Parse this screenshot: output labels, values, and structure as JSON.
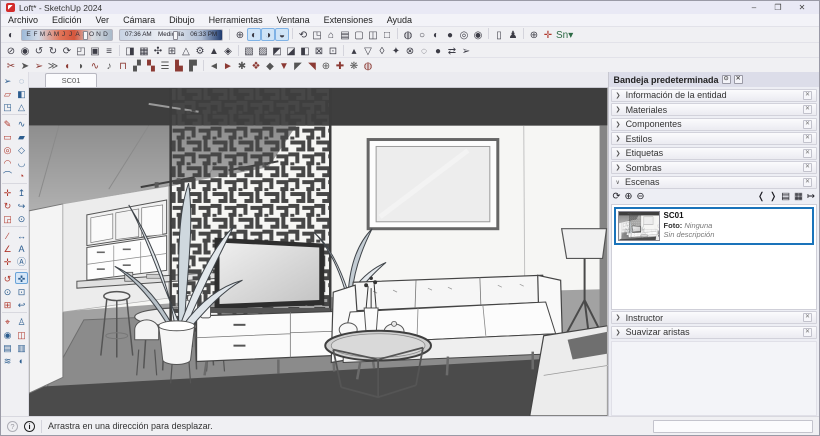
{
  "colors": {
    "accent": "#2b7cd3",
    "selection_border": "#1a73ba",
    "pressed_bg": "#cfe4f7",
    "shadow_red": "#d4563c"
  },
  "window": {
    "title": "Loft* - SketchUp 2024",
    "minimize": "–",
    "restore": "❐",
    "close": "✕"
  },
  "menu": {
    "items": [
      "Archivo",
      "Edición",
      "Ver",
      "Cámara",
      "Dibujo",
      "Herramientas",
      "Ventana",
      "Extensiones",
      "Ayuda"
    ]
  },
  "shadow_toolbar": {
    "toggle": {
      "n": "shadow-settings-icon",
      "g": "◐"
    },
    "months": [
      "E",
      "F",
      "M",
      "A",
      "M",
      "J",
      "J",
      "A",
      "S",
      "O",
      "N",
      "D"
    ],
    "time_start": "07:36 AM",
    "time_noon": "Mediodía",
    "time_end": "06:33 PM"
  },
  "toolbar_row1": [
    {
      "n": "compass-icon",
      "g": "⊕"
    },
    {
      "n": "shadows-toggle-icon",
      "g": "◐",
      "pressed": true
    },
    {
      "n": "shadow-on-faces-icon",
      "g": "◑",
      "pressed": true
    },
    {
      "n": "shadow-on-ground-icon",
      "g": "◒",
      "pressed": true
    },
    {
      "sep": true
    },
    {
      "n": "previous-view-icon",
      "g": "⟲"
    },
    {
      "n": "iso-view-icon",
      "g": "◳"
    },
    {
      "n": "home-view-icon",
      "g": "⌂"
    },
    {
      "n": "top-view-icon",
      "g": "▤"
    },
    {
      "n": "front-view-icon",
      "g": "▢"
    },
    {
      "n": "right-view-icon",
      "g": "◫"
    },
    {
      "n": "back-view-icon",
      "g": "□"
    },
    {
      "sep": true
    },
    {
      "n": "xray-style-icon",
      "g": "◍"
    },
    {
      "n": "wireframe-style-icon",
      "g": "○"
    },
    {
      "n": "hidden-line-style-icon",
      "g": "◐"
    },
    {
      "n": "shaded-style-icon",
      "g": "●"
    },
    {
      "n": "textured-style-icon",
      "g": "◎"
    },
    {
      "n": "monochrome-style-icon",
      "g": "◉"
    },
    {
      "sep": true
    },
    {
      "n": "new-file-icon",
      "g": "▯"
    },
    {
      "n": "person-scale-icon",
      "g": "♟"
    },
    {
      "sep": true
    },
    {
      "n": "geolocation-globe-icon",
      "g": "⊕"
    },
    {
      "n": "axes-icon",
      "g": "✛",
      "c": "#b0392e"
    },
    {
      "n": "sandbox-dropdown-icon",
      "g": "Sn▾",
      "c": "#2e6b46"
    }
  ],
  "toolbar_row2": [
    {
      "n": "extension-icon-r2-01",
      "g": "⊘"
    },
    {
      "n": "extension-icon-r2-02",
      "g": "◉"
    },
    {
      "n": "extension-icon-r2-03",
      "g": "↺"
    },
    {
      "n": "extension-icon-r2-04",
      "g": "↻"
    },
    {
      "n": "extension-icon-r2-05",
      "g": "⟳"
    },
    {
      "n": "extension-icon-r2-06",
      "g": "◰"
    },
    {
      "n": "extension-icon-r2-07",
      "g": "▣"
    },
    {
      "n": "extension-icon-r2-08",
      "g": "≡"
    },
    {
      "sep": true
    },
    {
      "n": "extension-icon-r2-09",
      "g": "◨"
    },
    {
      "n": "extension-icon-r2-10",
      "g": "▦"
    },
    {
      "n": "extension-icon-r2-11",
      "g": "✣"
    },
    {
      "n": "extension-icon-r2-12",
      "g": "⊞"
    },
    {
      "n": "extension-icon-r2-13",
      "g": "△"
    },
    {
      "n": "extension-icon-r2-14",
      "g": "⚙"
    },
    {
      "n": "extension-icon-r2-15",
      "g": "▲"
    },
    {
      "n": "extension-icon-r2-16",
      "g": "◈"
    },
    {
      "sep": true
    },
    {
      "n": "extension-icon-r2-17",
      "g": "▧"
    },
    {
      "n": "extension-icon-r2-18",
      "g": "▨"
    },
    {
      "n": "extension-icon-r2-19",
      "g": "◩"
    },
    {
      "n": "extension-icon-r2-20",
      "g": "◪"
    },
    {
      "n": "extension-icon-r2-21",
      "g": "◧"
    },
    {
      "n": "extension-icon-r2-22",
      "g": "⊠"
    },
    {
      "n": "extension-icon-r2-23",
      "g": "⊡"
    },
    {
      "sep": true
    },
    {
      "n": "extension-icon-r2-24",
      "g": "▴"
    },
    {
      "n": "extension-icon-r2-25",
      "g": "▽"
    },
    {
      "n": "extension-icon-r2-26",
      "g": "◊"
    },
    {
      "n": "extension-icon-r2-27",
      "g": "✦"
    },
    {
      "n": "extension-icon-r2-28",
      "g": "⊗"
    },
    {
      "n": "extension-icon-r2-29",
      "g": "◌"
    },
    {
      "n": "extension-icon-r2-30",
      "g": "●"
    },
    {
      "n": "extension-icon-r2-31",
      "g": "⇄"
    },
    {
      "n": "extension-icon-r2-32",
      "g": "➢"
    }
  ],
  "toolbar_row3": [
    {
      "n": "extension-icon-r3-01",
      "g": "✂"
    },
    {
      "n": "extension-icon-r3-02",
      "g": "➤"
    },
    {
      "n": "extension-icon-r3-03",
      "g": "➢"
    },
    {
      "n": "extension-icon-r3-04",
      "g": "≫"
    },
    {
      "n": "extension-icon-r3-05",
      "g": "◖"
    },
    {
      "n": "extension-icon-r3-06",
      "g": "◗"
    },
    {
      "n": "extension-icon-r3-07",
      "g": "∿"
    },
    {
      "n": "extension-icon-r3-08",
      "g": "♪"
    },
    {
      "n": "extension-icon-r3-09",
      "g": "⊓"
    },
    {
      "n": "extension-icon-r3-10",
      "g": "▞"
    },
    {
      "n": "extension-icon-r3-11",
      "g": "▚"
    },
    {
      "n": "extension-icon-r3-12",
      "g": "☰"
    },
    {
      "n": "extension-icon-r3-13",
      "g": "▙"
    },
    {
      "n": "extension-icon-r3-14",
      "g": "▛"
    },
    {
      "sep": true
    },
    {
      "n": "extension-icon-r3-15",
      "g": "◄"
    },
    {
      "n": "extension-icon-r3-16",
      "g": "►"
    },
    {
      "n": "extension-icon-r3-17",
      "g": "✱"
    },
    {
      "n": "extension-icon-r3-18",
      "g": "❖"
    },
    {
      "n": "extension-icon-r3-19",
      "g": "◆"
    },
    {
      "n": "extension-icon-r3-20",
      "g": "▼"
    },
    {
      "n": "extension-icon-r3-21",
      "g": "◤"
    },
    {
      "n": "extension-icon-r3-22",
      "g": "◥"
    },
    {
      "n": "extension-icon-r3-23",
      "g": "⊕"
    },
    {
      "n": "extension-icon-r3-24",
      "g": "✚"
    },
    {
      "n": "extension-icon-r3-25",
      "g": "❋"
    },
    {
      "n": "extension-icon-r3-26",
      "g": "◍"
    }
  ],
  "left_toolbar": [
    {
      "n": "select-tool",
      "g": "➢",
      "c": "#2c5d8f"
    },
    {
      "n": "lasso-select-tool",
      "g": "◌",
      "c": "#2c5d8f"
    },
    {
      "n": "eraser-tool",
      "g": "▱",
      "c": "#b0392e"
    },
    {
      "n": "paint-bucket-tool",
      "g": "◧",
      "c": "#2c5d8f"
    },
    {
      "n": "stamp-tool",
      "g": "◳",
      "c": "#2c5d8f"
    },
    {
      "n": "shapes-tool",
      "g": "△",
      "c": "#2c5d8f"
    },
    {
      "sep": true
    },
    {
      "n": "line-tool",
      "g": "✎",
      "c": "#b0392e"
    },
    {
      "n": "freehand-tool",
      "g": "∿",
      "c": "#2c5d8f"
    },
    {
      "n": "rectangle-tool",
      "g": "▭",
      "c": "#b0392e"
    },
    {
      "n": "rotated-rectangle-tool",
      "g": "▰",
      "c": "#2c5d8f"
    },
    {
      "n": "circle-tool",
      "g": "◎",
      "c": "#b0392e"
    },
    {
      "n": "polygon-tool",
      "g": "◇",
      "c": "#2c5d8f"
    },
    {
      "n": "arc-tool",
      "g": "◠",
      "c": "#b0392e"
    },
    {
      "n": "two-point-arc-tool",
      "g": "◡",
      "c": "#2c5d8f"
    },
    {
      "n": "three-point-arc-tool",
      "g": "⌒",
      "c": "#2c5d8f"
    },
    {
      "n": "pie-tool",
      "g": "◔",
      "c": "#b0392e"
    },
    {
      "sep": true
    },
    {
      "n": "move-tool",
      "g": "✛",
      "c": "#b0392e"
    },
    {
      "n": "push-pull-tool",
      "g": "↥",
      "c": "#2c5d8f"
    },
    {
      "n": "rotate-tool",
      "g": "↻",
      "c": "#b0392e"
    },
    {
      "n": "follow-me-tool",
      "g": "↪",
      "c": "#2c5d8f"
    },
    {
      "n": "scale-tool",
      "g": "◲",
      "c": "#b0392e"
    },
    {
      "n": "offset-tool",
      "g": "⊙",
      "c": "#2c5d8f"
    },
    {
      "sep": true
    },
    {
      "n": "tape-measure-tool",
      "g": "∕",
      "c": "#b0392e"
    },
    {
      "n": "dimension-tool",
      "g": "↔",
      "c": "#2c5d8f"
    },
    {
      "n": "protractor-tool",
      "g": "∠",
      "c": "#b0392e"
    },
    {
      "n": "text-tool",
      "g": "A",
      "c": "#2c5d8f"
    },
    {
      "n": "axes-tool",
      "g": "✛",
      "c": "#b0392e"
    },
    {
      "n": "3d-text-tool",
      "g": "Ⓐ",
      "c": "#2c5d8f"
    },
    {
      "sep": true
    },
    {
      "n": "orbit-tool",
      "g": "↺",
      "c": "#b0392e"
    },
    {
      "n": "pan-tool",
      "g": "✜",
      "c": "#2c5d8f",
      "sel": true
    },
    {
      "n": "zoom-tool",
      "g": "⊙",
      "c": "#2c5d8f"
    },
    {
      "n": "zoom-window-tool",
      "g": "⊡",
      "c": "#2c5d8f"
    },
    {
      "n": "zoom-extents-tool",
      "g": "⊞",
      "c": "#b0392e"
    },
    {
      "n": "previous-view-tool",
      "g": "↩",
      "c": "#2c5d8f"
    },
    {
      "sep": true
    },
    {
      "n": "position-camera-tool",
      "g": "⌖",
      "c": "#b0392e"
    },
    {
      "n": "walk-tool",
      "g": "♙",
      "c": "#2c5d8f"
    },
    {
      "n": "look-around-tool",
      "g": "◉",
      "c": "#2c5d8f"
    },
    {
      "n": "section-plane-tool",
      "g": "◫",
      "c": "#b0392e"
    },
    {
      "n": "section-display-icon",
      "g": "▤",
      "c": "#2c5d8f"
    },
    {
      "n": "section-cut-icon",
      "g": "▥",
      "c": "#2c5d8f"
    },
    {
      "n": "fog-icon",
      "g": "≋",
      "c": "#2c5d8f"
    },
    {
      "n": "shadows-icon",
      "g": "◐",
      "c": "#2c5d8f"
    }
  ],
  "viewport": {
    "tab": "SC01"
  },
  "tray": {
    "title": "Bandeja predeterminada",
    "pin_icon": "⊙",
    "close_icon": "✕",
    "chevron_collapsed": "❯",
    "chevron_expanded": "∨",
    "sections_top": [
      {
        "label": "Información de la entidad"
      },
      {
        "label": "Materiales"
      },
      {
        "label": "Componentes"
      },
      {
        "label": "Estilos"
      },
      {
        "label": "Etiquetas"
      },
      {
        "label": "Sombras"
      }
    ],
    "scenes": {
      "label": "Escenas",
      "toolbar_left": [
        {
          "n": "update-scene-icon",
          "g": "⟳"
        },
        {
          "n": "add-scene-icon",
          "g": "⊕"
        },
        {
          "n": "remove-scene-icon",
          "g": "⊖"
        }
      ],
      "toolbar_right": [
        {
          "n": "move-scene-down-icon",
          "g": "❬"
        },
        {
          "n": "move-scene-up-icon",
          "g": "❭"
        },
        {
          "n": "view-options-icon",
          "g": "▤"
        },
        {
          "n": "show-thumbnails-icon",
          "g": "▦"
        },
        {
          "n": "show-details-icon",
          "g": "↦"
        }
      ],
      "items": [
        {
          "name": "SC01",
          "photo_label": "Foto:",
          "photo_value": "Ninguna",
          "description": "Sin descripción"
        }
      ]
    },
    "sections_bottom": [
      {
        "label": "Instructor"
      },
      {
        "label": "Suavizar aristas"
      }
    ]
  },
  "statusbar": {
    "help_icon": "?",
    "info_icon": "i",
    "hint": "Arrastra en una dirección para desplazar.",
    "measure_value": ""
  }
}
